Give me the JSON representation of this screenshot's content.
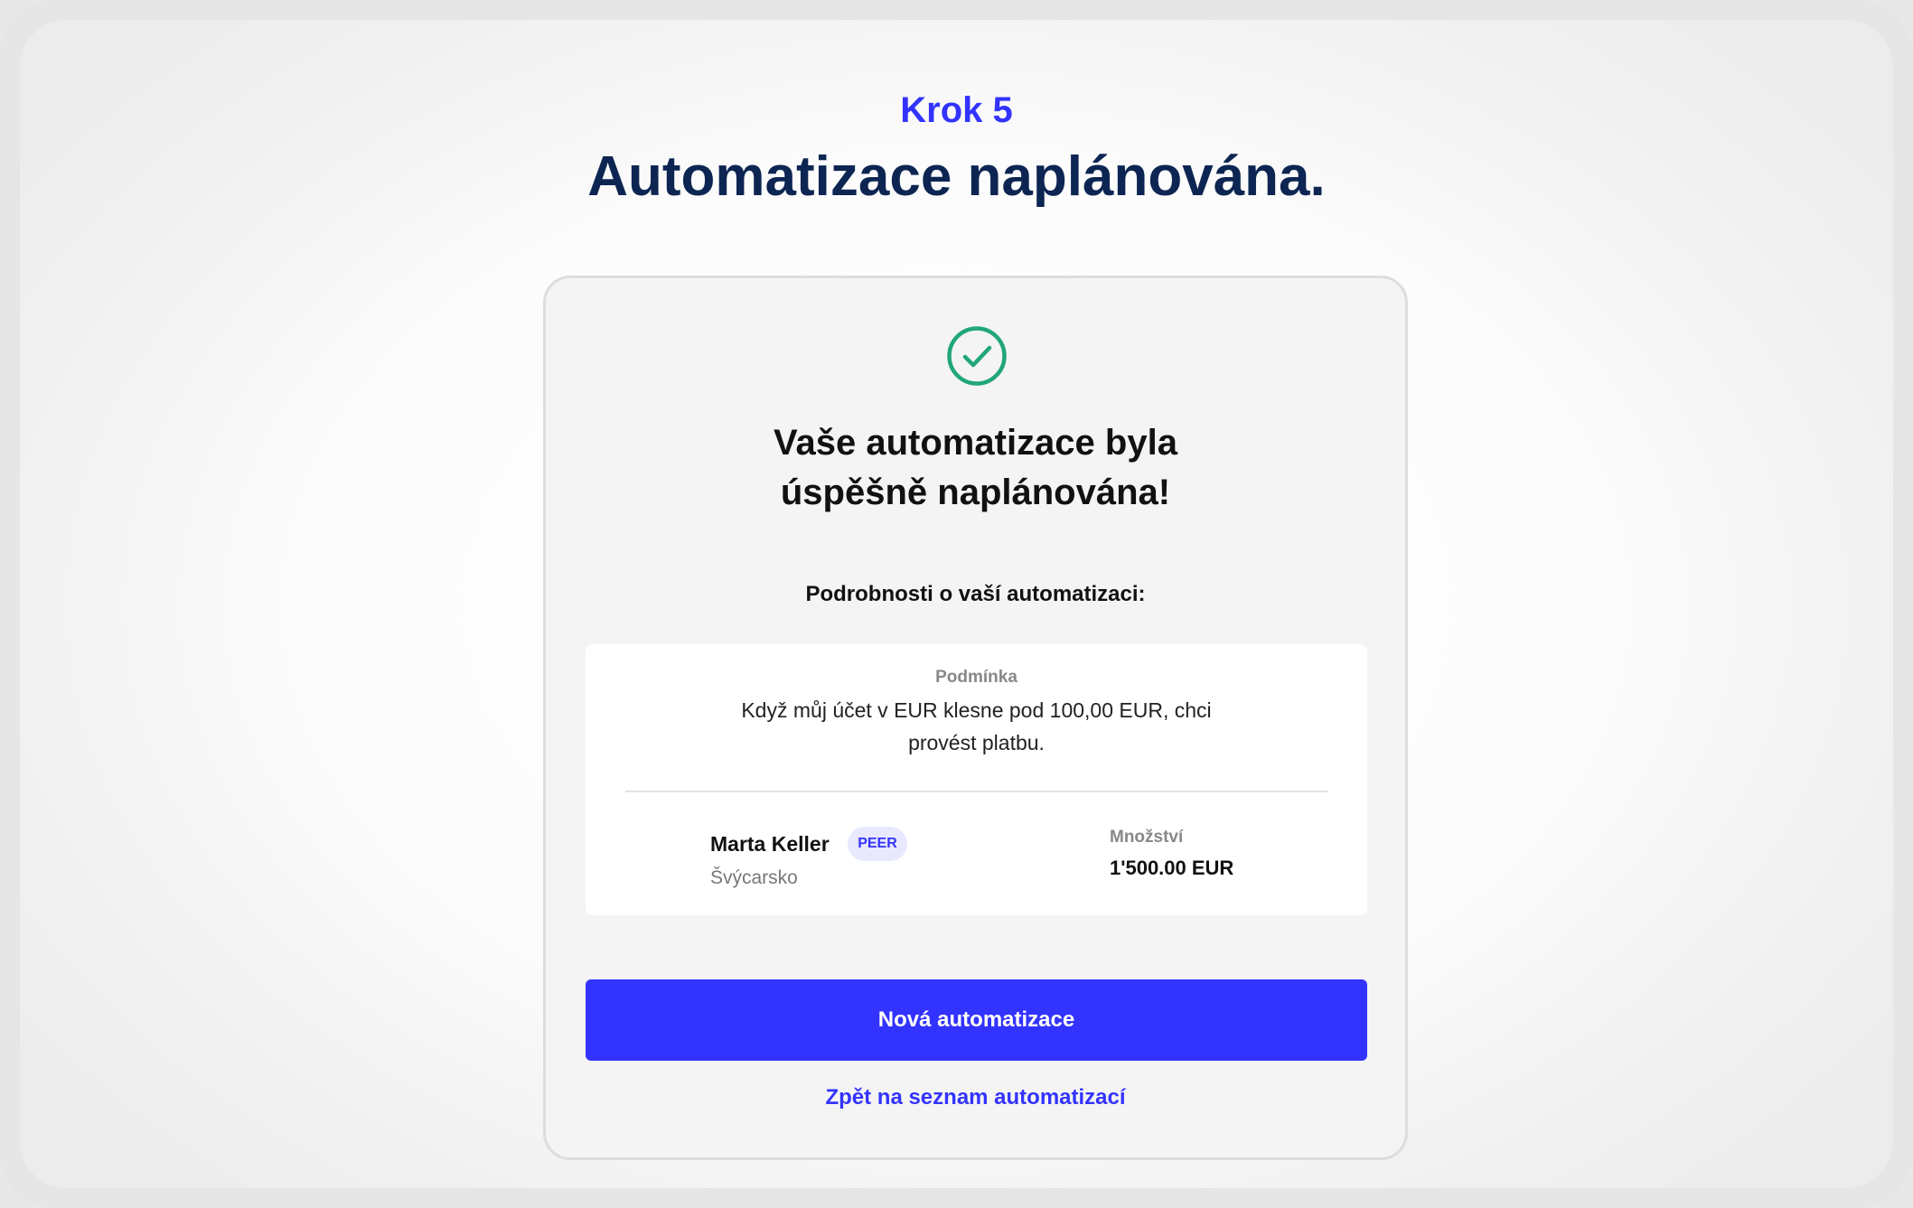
{
  "header": {
    "step_label": "Krok 5",
    "title": "Automatizace naplánována."
  },
  "card": {
    "icon": "check-circle-icon",
    "success_color": "#22a67a",
    "heading_line1": "Vaše automatizace byla",
    "heading_line2": "úspěšně naplánována!",
    "details_label": "Podrobnosti o vaší automatizaci:",
    "details": {
      "condition_label": "Podmínka",
      "condition_text": "Když můj účet v EUR klesne pod 100,00 EUR, chci provést platbu.",
      "recipient": {
        "name": "Marta Keller",
        "badge": "PEER",
        "country": "Švýcarsko"
      },
      "amount": {
        "label": "Množství",
        "value": "1'500.00 EUR"
      }
    },
    "primary_button": "Nová automatizace",
    "back_link": "Zpět na seznam automatizací"
  },
  "colors": {
    "accent": "#3333ff",
    "title": "#0d2552"
  }
}
